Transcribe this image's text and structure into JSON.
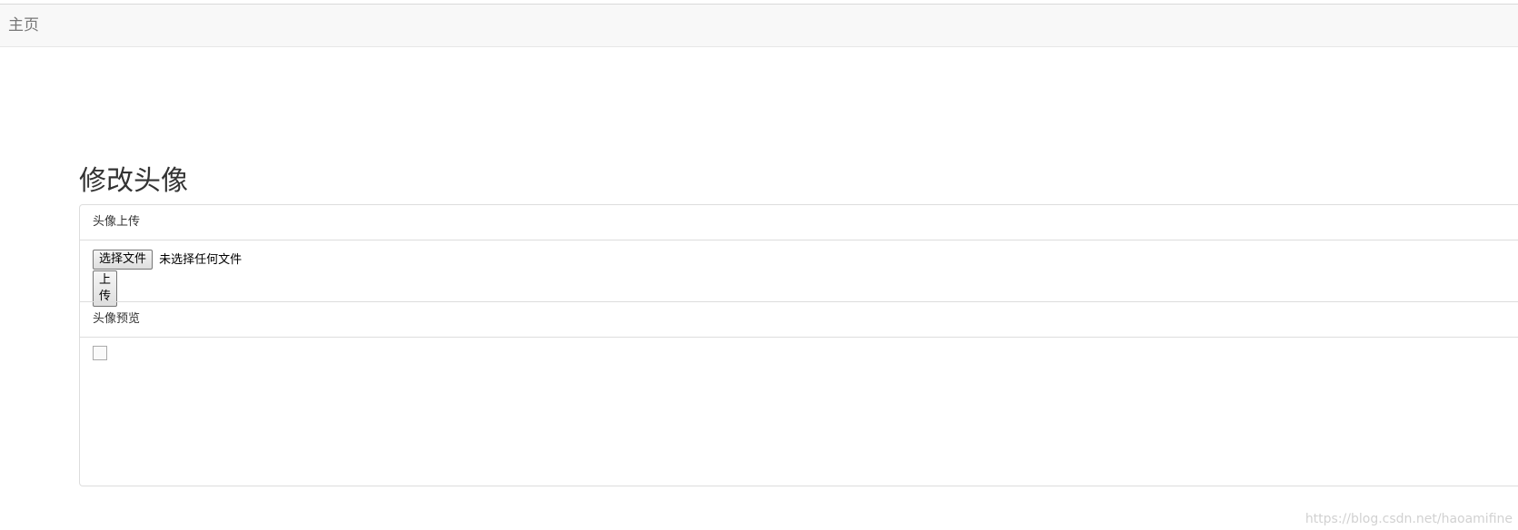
{
  "navbar": {
    "brand_label": "主页"
  },
  "page": {
    "title": "修改头像"
  },
  "upload_panel": {
    "heading": "头像上传",
    "choose_file_label": "选择文件",
    "file_status": "未选择任何文件",
    "upload_label": "上传"
  },
  "preview_panel": {
    "heading": "头像预览"
  },
  "watermark": "https://blog.csdn.net/haoamifine"
}
